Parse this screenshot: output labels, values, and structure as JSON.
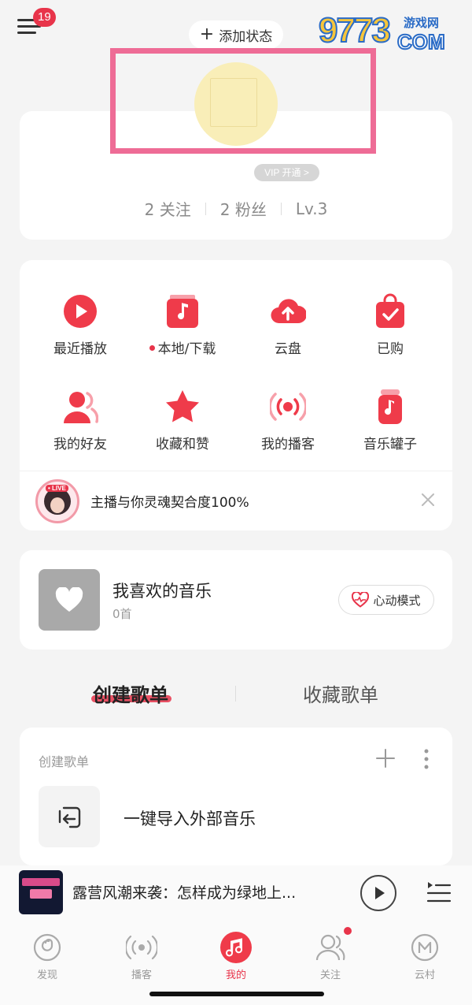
{
  "header": {
    "notification_count": "19",
    "add_status_label": "添加状态"
  },
  "watermark": {
    "number": "9773",
    "site": "游戏网",
    "domain": "COM"
  },
  "profile": {
    "vip_label": "VIP 开通 >",
    "following": "2 关注",
    "followers": "2 粉丝",
    "level": "Lv.3"
  },
  "shortcuts": [
    {
      "label": "最近播放",
      "icon": "play-circle-icon"
    },
    {
      "label": "本地/下载",
      "icon": "music-folder-icon"
    },
    {
      "label": "云盘",
      "icon": "cloud-upload-icon"
    },
    {
      "label": "已购",
      "icon": "shopping-bag-icon"
    },
    {
      "label": "我的好友",
      "icon": "friends-icon"
    },
    {
      "label": "收藏和赞",
      "icon": "star-icon"
    },
    {
      "label": "我的播客",
      "icon": "broadcast-icon"
    },
    {
      "label": "音乐罐子",
      "icon": "music-jar-icon"
    }
  ],
  "live_banner": {
    "tag": "• LIVE",
    "text": "主播与你灵魂契合度100%"
  },
  "liked_music": {
    "title": "我喜欢的音乐",
    "count": "0首",
    "mode_button": "心动模式"
  },
  "tabs": {
    "create": "创建歌单",
    "collect": "收藏歌单"
  },
  "playlist_section": {
    "header": "创建歌单",
    "import_label": "一键导入外部音乐"
  },
  "now_playing": {
    "title": "露营风潮来袭：怎样成为绿地上..."
  },
  "bottom_nav": [
    {
      "label": "发现"
    },
    {
      "label": "播客"
    },
    {
      "label": "我的"
    },
    {
      "label": "关注"
    },
    {
      "label": "云村"
    }
  ],
  "colors": {
    "accent": "#e8344a",
    "highlight_box": "#ee6c96",
    "avatar_placeholder": "#f9eeb8"
  }
}
